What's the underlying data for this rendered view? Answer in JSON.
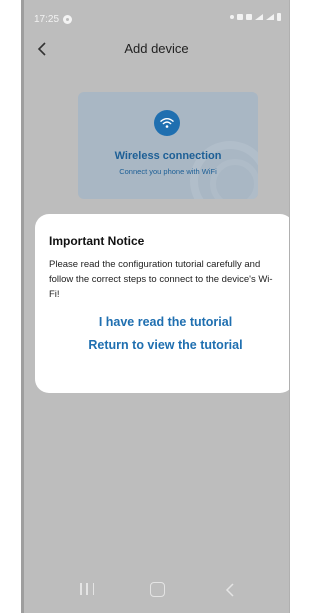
{
  "status_bar": {
    "time": "17:25"
  },
  "header": {
    "title": "Add device"
  },
  "wifi_card": {
    "title": "Wireless connection",
    "subtitle": "Connect you phone with WiFi",
    "accent_color": "#1f6fb0"
  },
  "modal": {
    "title": "Important Notice",
    "body": "Please read the configuration tutorial carefully and follow the correct steps to connect to the device's Wi-Fi!",
    "actions": {
      "read": "I have read the tutorial",
      "return": "Return to view the tutorial"
    },
    "action_color": "#1f6fb0"
  },
  "nav_bar": {
    "buttons": [
      "recent-apps-icon",
      "home-icon",
      "back-icon"
    ]
  }
}
